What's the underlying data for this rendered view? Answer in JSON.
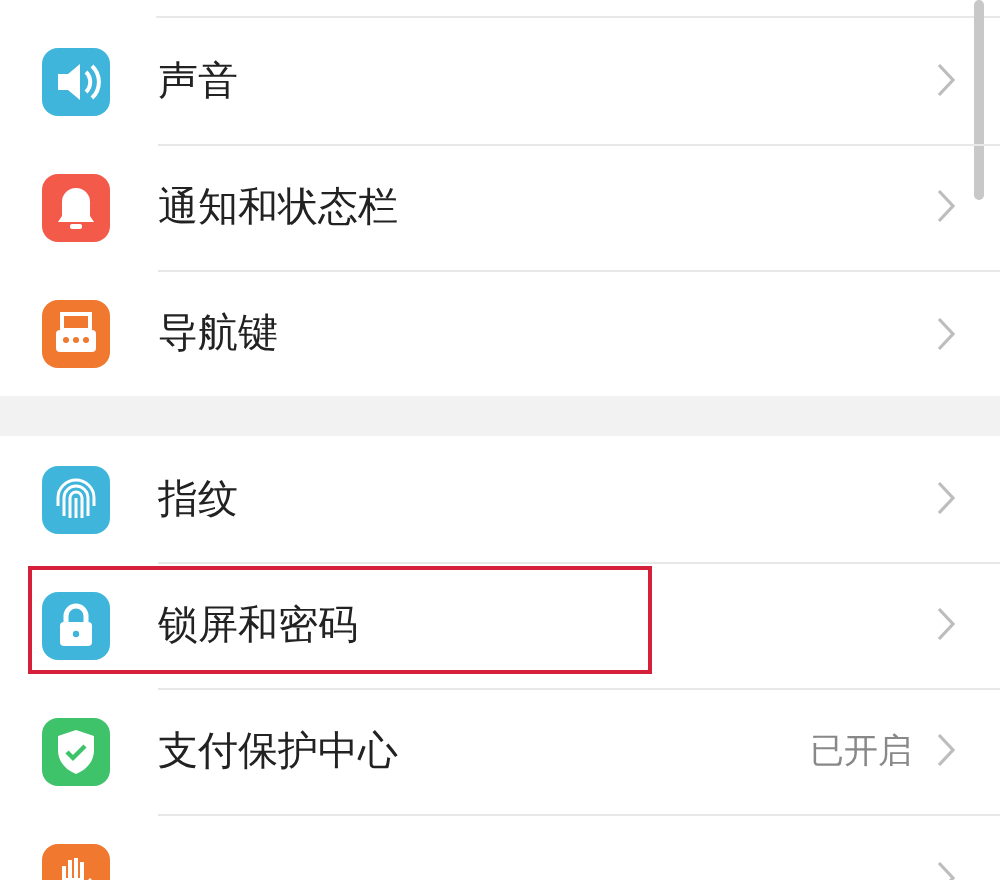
{
  "groups": [
    {
      "items": [
        {
          "label": "声音",
          "highlighted": false
        },
        {
          "label": "通知和状态栏",
          "highlighted": false
        },
        {
          "label": "导航键",
          "highlighted": false
        }
      ]
    },
    {
      "items": [
        {
          "label": "指纹",
          "highlighted": false
        },
        {
          "label": "锁屏和密码",
          "highlighted": true
        },
        {
          "label": "支付保护中心",
          "value": "已开启",
          "highlighted": false
        },
        {
          "highlighted": false
        }
      ]
    }
  ]
}
